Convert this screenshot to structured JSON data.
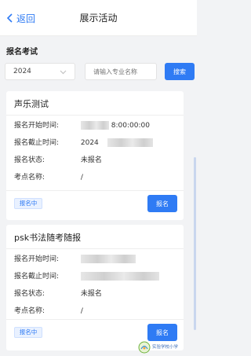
{
  "navbar": {
    "back_label": "返回",
    "title": "展示活动"
  },
  "section": {
    "title": "报名考试"
  },
  "filters": {
    "year": "2024",
    "search_placeholder": "请输入专业名称",
    "search_button": "搜索"
  },
  "cards": [
    {
      "title": "声乐测试",
      "start_label": "报名开始时间:",
      "start_value_visible": "8:00:00:00",
      "end_label": "报名截止时间:",
      "end_value_visible": "2024",
      "status_label": "报名状态:",
      "status_value": "未报名",
      "venue_label": "考点名称:",
      "venue_value": "/",
      "badge": "报名中",
      "button": "报名"
    },
    {
      "title": "psk书法随考随报",
      "start_label": "报名开始时间:",
      "end_label": "报名截止时间:",
      "status_label": "报名状态:",
      "status_value": "未报名",
      "venue_label": "考点名称:",
      "venue_value": "/",
      "badge": "报名中",
      "button": "报名"
    }
  ],
  "watermark": {
    "text": "实验学校小学",
    "icon": "school-logo-icon"
  },
  "colors": {
    "accent": "#2f7bf4",
    "background": "#f2f3f5",
    "badge_bg": "#e9f1ff"
  }
}
